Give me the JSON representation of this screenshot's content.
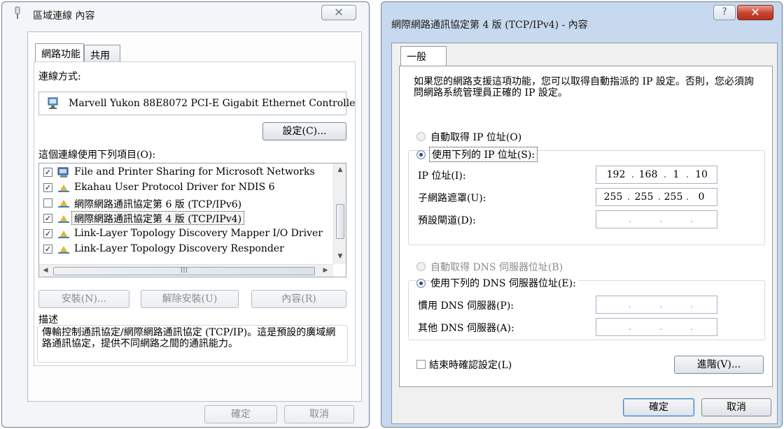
{
  "left_dialog": {
    "title": "區域連線 內容",
    "close_glyph": "✕",
    "tabs": [
      {
        "label": "網路功能"
      },
      {
        "label": "共用"
      }
    ],
    "connect_using_label": "連線方式:",
    "adapter_name": "Marvell Yukon 88E8072 PCI-E Gigabit Ethernet Controlle",
    "configure_button": "設定(C)...",
    "items_label": "這個連線使用下列項目(O):",
    "items": [
      {
        "label": "File and Printer Sharing for Microsoft Networks",
        "checked": true,
        "icon": "network-share-icon"
      },
      {
        "label": "Ekahau User Protocol Driver for NDIS 6",
        "checked": true,
        "icon": "protocol-icon"
      },
      {
        "label": "網際網路通訊協定第 6 版 (TCP/IPv6)",
        "checked": false,
        "icon": "protocol-icon"
      },
      {
        "label": "網際網路通訊協定第 4 版 (TCP/IPv4)",
        "checked": true,
        "icon": "protocol-icon",
        "selected": true
      },
      {
        "label": "Link-Layer Topology Discovery Mapper I/O Driver",
        "checked": true,
        "icon": "protocol-icon"
      },
      {
        "label": "Link-Layer Topology Discovery Responder",
        "checked": true,
        "icon": "protocol-icon"
      }
    ],
    "scroll_h_thumb_glyph": "III",
    "install_button": "安裝(N)...",
    "uninstall_button": "解除安裝(U)",
    "properties_button": "內容(R)",
    "description_title": "描述",
    "description_text": "傳輸控制通訊協定/網際網路通訊協定 (TCP/IP)。這是預設的廣域網路通訊協定，提供不同網路之間的通訊能力。",
    "ok_button": "確定",
    "cancel_button": "取消"
  },
  "right_dialog": {
    "title": "網際網路通訊協定第 4 版 (TCP/IPv4) - 內容",
    "help_glyph": "?",
    "close_glyph": "✕",
    "tab": "一般",
    "intro_text": "如果您的網路支援這項功能，您可以取得自動指派的 IP 設定。否則，您必須詢問網路系統管理員正確的 IP 設定。",
    "obtain_ip_auto": "自動取得 IP 位址(O)",
    "use_following_ip": "使用下列的 IP 位址(S):",
    "ip_address_label": "IP 位址(I):",
    "ip_address": [
      "192",
      "168",
      "1",
      "10"
    ],
    "subnet_mask_label": "子網路遮罩(U):",
    "subnet_mask": [
      "255",
      "255",
      "255",
      "0"
    ],
    "default_gateway_label": "預設閘道(D):",
    "obtain_dns_auto": "自動取得 DNS 伺服器位址(B)",
    "use_following_dns": "使用下列的 DNS 伺服器位址(E):",
    "preferred_dns_label": "慣用 DNS 伺服器(P):",
    "alternate_dns_label": "其他 DNS 伺服器(A):",
    "validate_on_exit": "結束時確認設定(L)",
    "advanced_button": "進階(V)...",
    "ok_button": "確定",
    "cancel_button": "取消"
  },
  "colors": {
    "title_bar": "#dbe7f3",
    "selected_radio": "#1d4f9c",
    "close_red": "#c9412e",
    "default_button_border": "#3f7ec5"
  }
}
